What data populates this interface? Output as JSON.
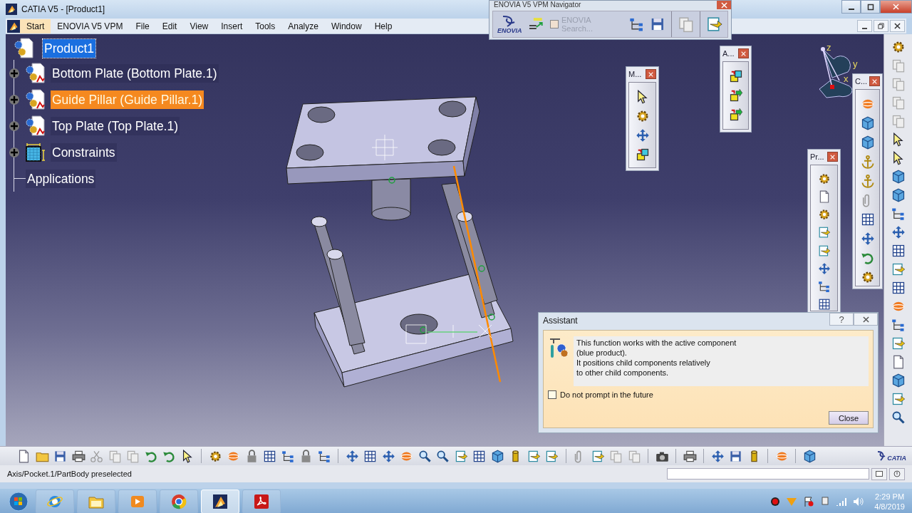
{
  "window": {
    "title": "CATIA V5 - [Product1]"
  },
  "menu": [
    {
      "label": "Start",
      "selected": true
    },
    {
      "label": "ENOVIA V5 VPM",
      "selected": false
    },
    {
      "label": "File",
      "selected": false
    },
    {
      "label": "Edit",
      "selected": false
    },
    {
      "label": "View",
      "selected": false
    },
    {
      "label": "Insert",
      "selected": false
    },
    {
      "label": "Tools",
      "selected": false
    },
    {
      "label": "Analyze",
      "selected": false
    },
    {
      "label": "Window",
      "selected": false
    },
    {
      "label": "Help",
      "selected": false
    }
  ],
  "navigator": {
    "title": "ENOVIA V5 VPM Navigator",
    "logo_text": "ENOVIA",
    "search": {
      "label": "ENOVIA Search...",
      "checked": false,
      "disabled": true
    }
  },
  "tree": {
    "label": "Product1",
    "kind": "product",
    "selected": true,
    "preselected": false,
    "children": [
      {
        "label": "Bottom Plate (Bottom Plate.1)",
        "kind": "part",
        "collapsed": true,
        "selected": false,
        "preselected": false
      },
      {
        "label": "Guide Pillar (Guide Pillar.1)",
        "kind": "part",
        "collapsed": true,
        "selected": false,
        "preselected": true
      },
      {
        "label": "Top Plate (Top Plate.1)",
        "kind": "part",
        "collapsed": true,
        "selected": false,
        "preselected": false
      },
      {
        "label": "Constraints",
        "kind": "constraints",
        "collapsed": true,
        "selected": false,
        "preselected": false
      },
      {
        "label": "Applications",
        "kind": "applications",
        "collapsed": false,
        "selected": false,
        "preselected": false
      }
    ]
  },
  "compass": {
    "axes": [
      "z",
      "y",
      "x"
    ]
  },
  "toolbars": [
    {
      "title": "M..."
    },
    {
      "title": "A..."
    },
    {
      "title": "Pr..."
    },
    {
      "title": "C..."
    }
  ],
  "assistant": {
    "title": "Assistant",
    "help": "?",
    "message": "This function works with the active component\n(blue product).\nIt positions child components relatively\nto other child components.",
    "checkbox": {
      "label": "Do not prompt in the future",
      "checked": false
    },
    "button": "Close"
  },
  "logo": {
    "text": "CATIA"
  },
  "status_bar": {
    "text": "Axis/Pocket.1/PartBody preselected"
  },
  "taskbar": {
    "apps": [
      {
        "kind": "ie",
        "active": false
      },
      {
        "kind": "explorer",
        "active": false
      },
      {
        "kind": "media",
        "active": false
      },
      {
        "kind": "chrome",
        "active": false
      },
      {
        "kind": "catia",
        "active": true
      },
      {
        "kind": "acrobat",
        "active": false
      }
    ],
    "clock": {
      "time": "2:29 PM",
      "date": "4/8/2019"
    }
  }
}
